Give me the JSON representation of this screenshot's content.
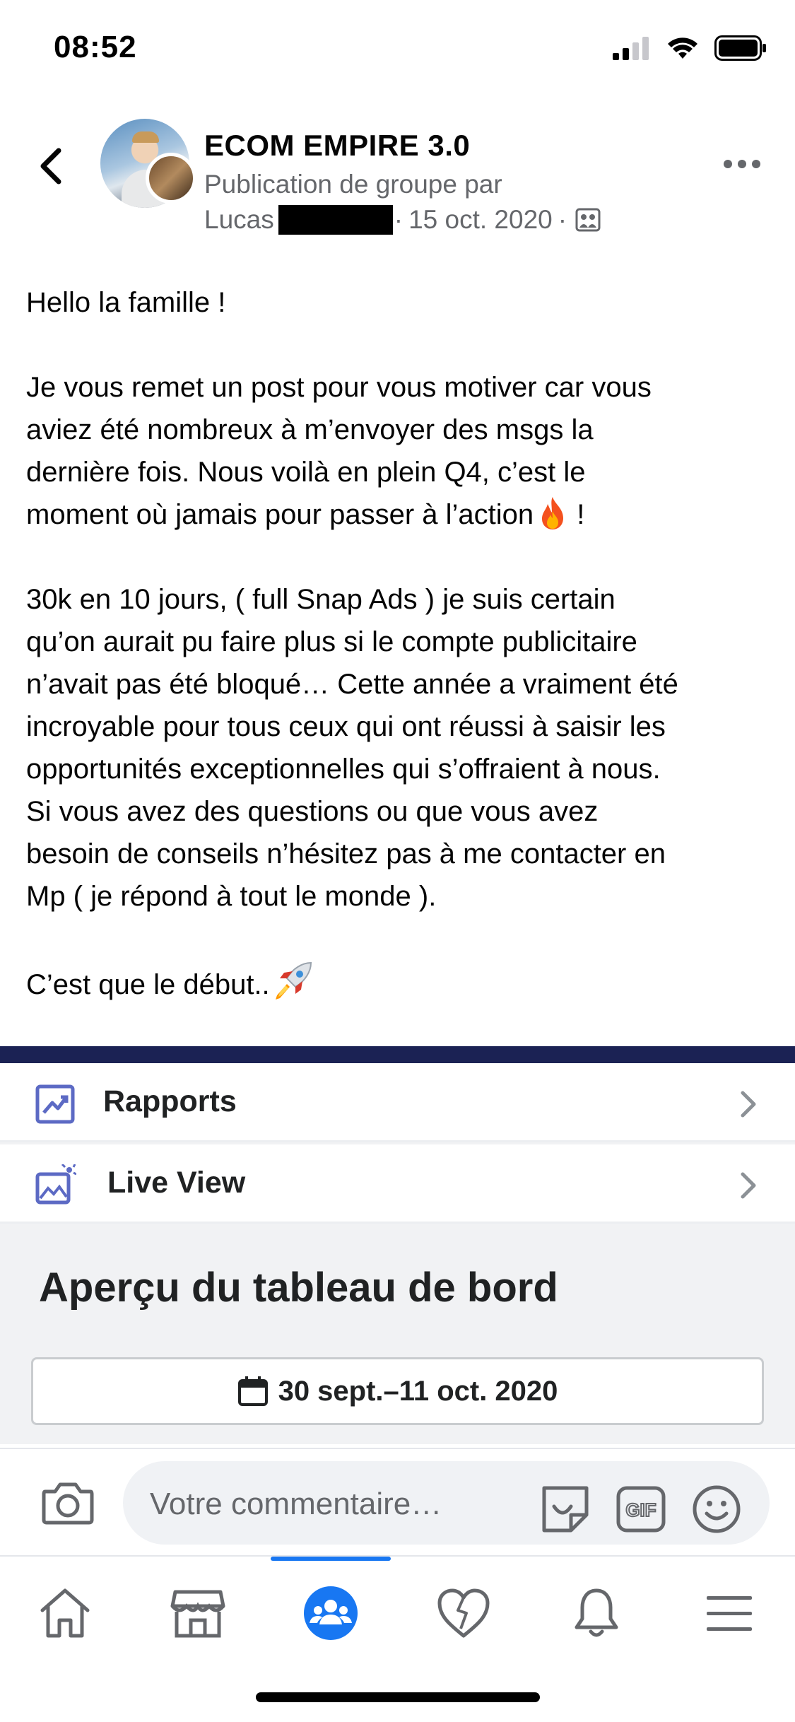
{
  "status_bar": {
    "time": "08:52"
  },
  "post": {
    "group_name": "ECOM EMPIRE 3.0",
    "subtitle": "Publication de groupe par",
    "author": "Lucas",
    "date": "15 oct. 2020",
    "separator": "·",
    "paragraphs": [
      [
        "Hello la famille !"
      ],
      [
        "Je vous remet un post pour vous motiver car vous",
        "aviez été nombreux à m’envoyer des msgs la",
        "dernière fois. Nous voilà en plein Q4, c’est le",
        "moment où jamais pour passer à l’action"
      ],
      [
        "30k en 10 jours, ( full Snap Ads ) je suis certain",
        "qu’on aurait pu faire plus si le compte publicitaire",
        "n’avait pas été bloqué… Cette année a vraiment été",
        "incroyable pour tous ceux qui ont réussi à saisir les",
        "opportunités exceptionnelles qui s’offraient à nous.",
        "Si vous avez des questions ou que vous avez",
        "besoin de conseils n’hésitez pas à me contacter en",
        "Mp ( je répond à tout le monde )."
      ],
      [
        "C’est que le début.."
      ]
    ],
    "action_suffix": " !",
    "emojis": [
      "fire",
      "rocket"
    ]
  },
  "screenshot": {
    "rows": [
      {
        "label": "Rapports",
        "icon": "reports-icon"
      },
      {
        "label": "Live View",
        "icon": "live-view-icon"
      }
    ],
    "title": "Aperçu du tableau de bord",
    "date_range": "30 sept.–11 oct. 2020"
  },
  "comment": {
    "placeholder": "Votre commentaire…"
  },
  "tabs": [
    {
      "name": "home",
      "active": false
    },
    {
      "name": "marketplace",
      "active": false
    },
    {
      "name": "groups",
      "active": true
    },
    {
      "name": "dating",
      "active": false
    },
    {
      "name": "notifications",
      "active": false
    },
    {
      "name": "menu",
      "active": false
    }
  ],
  "colors": {
    "accent": "#1877f2",
    "secondary_text": "#65676b",
    "dark_band": "#1b2254",
    "comment_bg": "#f0f2f5"
  }
}
